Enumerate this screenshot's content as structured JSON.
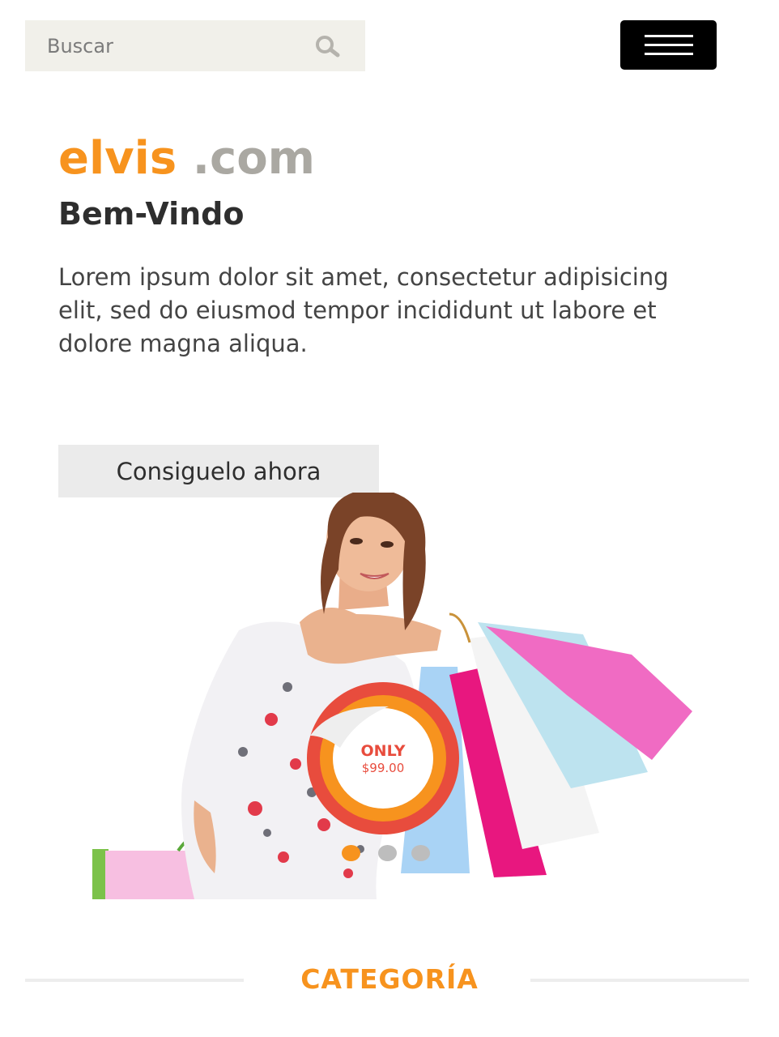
{
  "search": {
    "placeholder": "Buscar"
  },
  "brand": {
    "name_part1": "elvis",
    "name_part2": ".com"
  },
  "hero": {
    "heading": "Bem-Vindo",
    "description": "Lorem ipsum dolor sit amet, consectetur adipisicing elit, sed do eiusmod tempor incididunt ut labore et dolore magna aliqua.",
    "cta_label": "Consiguelo ahora",
    "badge_line1": "ONLY",
    "badge_line2": "$99.00",
    "active_slide": 1,
    "slide_count": 3
  },
  "categories": {
    "title": "CATEGORÍA"
  },
  "colors": {
    "accent": "#f7931e",
    "brand_secondary": "#aaa8a2",
    "heading": "#2e2e2e",
    "search_bg": "#f1f0ea",
    "menu_bg": "#000000",
    "dot_active": "#f7931e",
    "dot_inactive": "#bdbdbd"
  },
  "icons": {
    "search": "search-icon",
    "menu": "hamburger-menu-icon"
  }
}
